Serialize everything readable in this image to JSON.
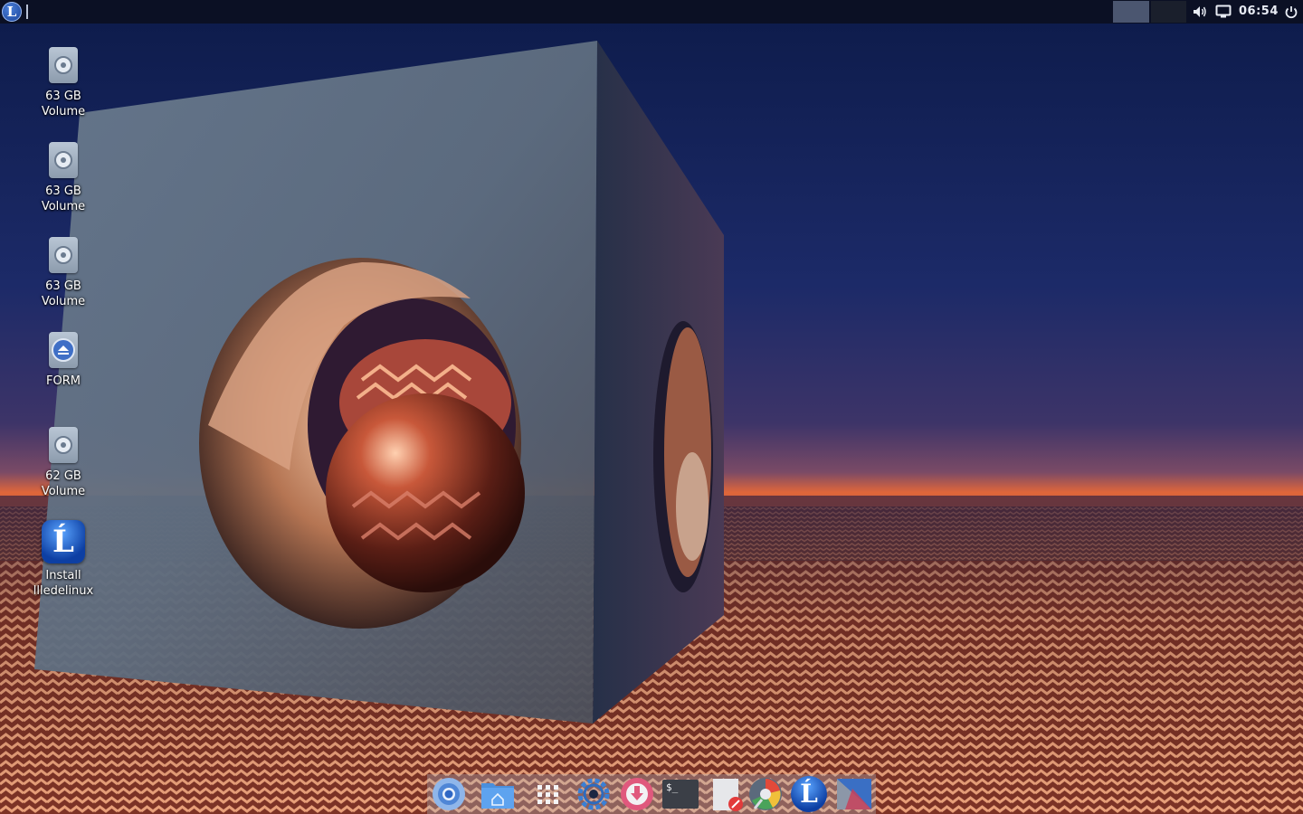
{
  "panel": {
    "menu_glyph": "L",
    "clock": "06:54",
    "workspaces": [
      "workspace-1",
      "workspace-2"
    ],
    "active_workspace": 1,
    "tray_icons": [
      "volume-icon",
      "display-icon",
      "power-icon"
    ]
  },
  "desktop": {
    "icons": [
      {
        "label_line1": "63 GB",
        "label_line2": "Volume",
        "icon": "drive-icon"
      },
      {
        "label_line1": "63 GB",
        "label_line2": "Volume",
        "icon": "drive-icon"
      },
      {
        "label_line1": "63 GB",
        "label_line2": "Volume",
        "icon": "drive-icon"
      },
      {
        "label_line1": "FORM",
        "label_line2": "",
        "icon": "eject-drive-icon"
      },
      {
        "label_line1": "62 GB",
        "label_line2": "Volume",
        "icon": "drive-icon"
      },
      {
        "label_line1": "Install",
        "label_line2": "llledelinux",
        "icon": "installer-logo-icon",
        "glyph": "Ĺ"
      }
    ]
  },
  "dock": {
    "items": [
      {
        "name": "chromium-browser-icon"
      },
      {
        "name": "home-folder-icon"
      },
      {
        "name": "app-grid-icon"
      },
      {
        "name": "settings-gear-icon"
      },
      {
        "name": "downloader-icon"
      },
      {
        "name": "terminal-icon",
        "text": "$_"
      },
      {
        "name": "text-editor-icon"
      },
      {
        "name": "disk-usage-icon"
      },
      {
        "name": "distro-logo-icon",
        "text": "Ĺ"
      },
      {
        "name": "image-viewer-icon"
      }
    ]
  },
  "colors": {
    "panel_bg": "#0b1024",
    "sky_top": "#0f1e4e",
    "horizon": "#e46a3a",
    "floor": "#b4533a",
    "cube": "#5b6f86",
    "sphere": "#8a3a22"
  }
}
